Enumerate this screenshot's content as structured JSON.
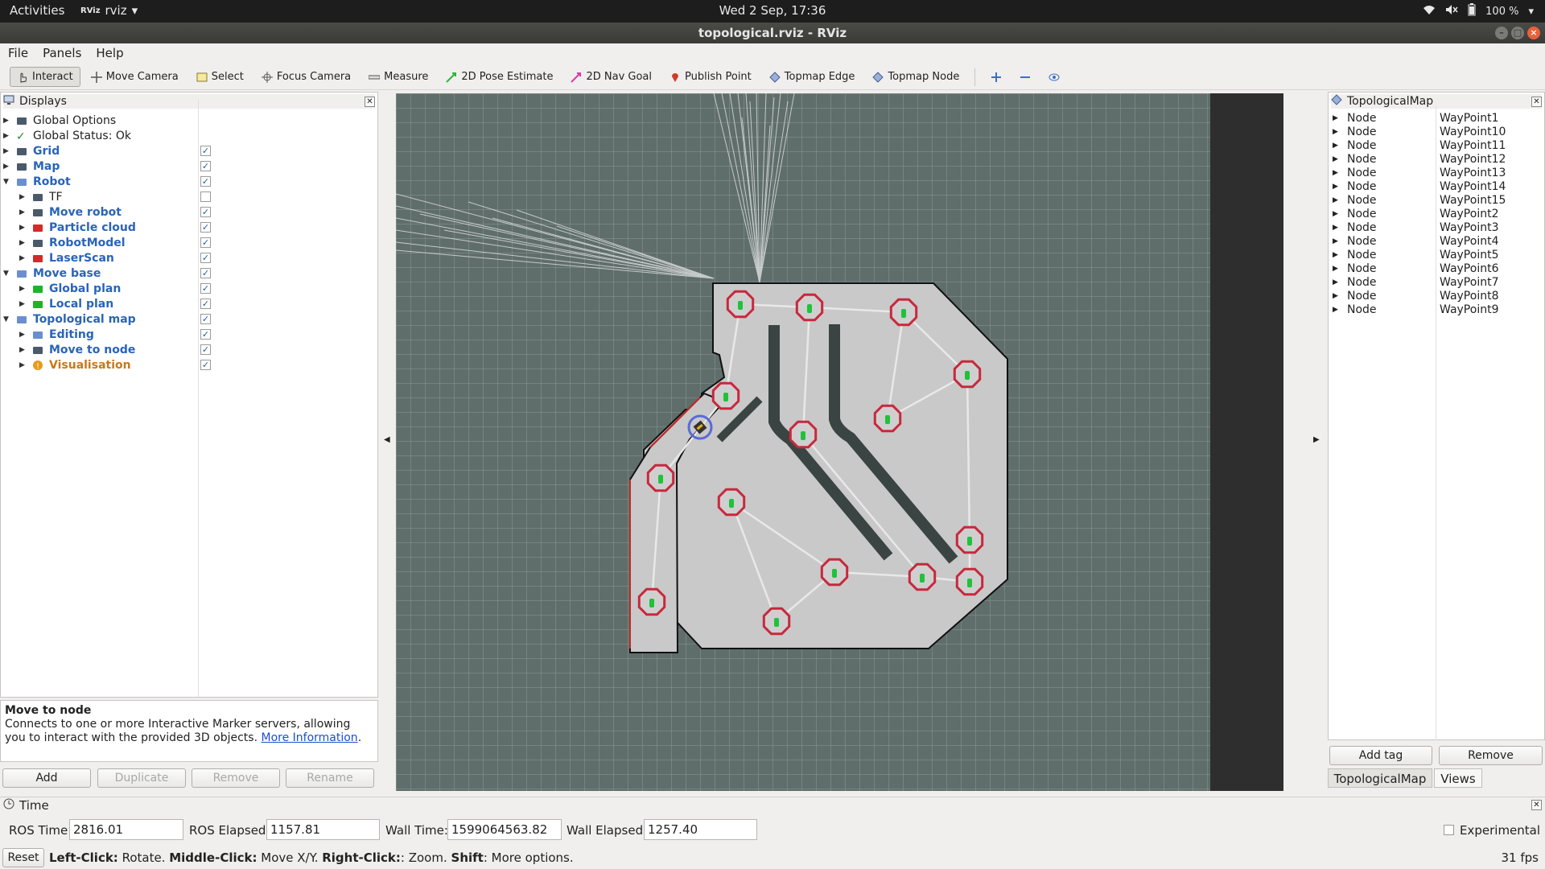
{
  "topbar": {
    "activities": "Activities",
    "app_badge": "RViz",
    "app_name": "rviz",
    "clock": "Wed  2 Sep, 17:36",
    "battery": "100 %"
  },
  "window": {
    "title": "topological.rviz - RViz"
  },
  "menu": {
    "file": "File",
    "panels": "Panels",
    "help": "Help"
  },
  "toolbar": {
    "interact": "Interact",
    "move_camera": "Move Camera",
    "select": "Select",
    "focus_camera": "Focus Camera",
    "measure": "Measure",
    "pose_estimate": "2D Pose Estimate",
    "nav_goal": "2D Nav Goal",
    "publish_point": "Publish Point",
    "topmap_edge": "Topmap Edge",
    "topmap_node": "Topmap Node"
  },
  "displays": {
    "title": "Displays",
    "items": [
      {
        "label": "Global Options",
        "style": "plain",
        "check": null
      },
      {
        "label": "Global Status: Ok",
        "style": "plain",
        "check": null
      },
      {
        "label": "Grid",
        "style": "blue",
        "check": "✓"
      },
      {
        "label": "Map",
        "style": "blue",
        "check": "✓"
      },
      {
        "label": "Robot",
        "style": "blue",
        "check": "✓"
      },
      {
        "label": "TF",
        "style": "plain",
        "check": ""
      },
      {
        "label": "Move robot",
        "style": "blue",
        "check": "✓"
      },
      {
        "label": "Particle cloud",
        "style": "blue",
        "check": "✓"
      },
      {
        "label": "RobotModel",
        "style": "blue",
        "check": "✓"
      },
      {
        "label": "LaserScan",
        "style": "blue",
        "check": "✓"
      },
      {
        "label": "Move base",
        "style": "blue",
        "check": "✓"
      },
      {
        "label": "Global plan",
        "style": "blue",
        "check": "✓"
      },
      {
        "label": "Local plan",
        "style": "blue",
        "check": "✓"
      },
      {
        "label": "Topological map",
        "style": "blue",
        "check": "✓"
      },
      {
        "label": "Editing",
        "style": "blue",
        "check": "✓"
      },
      {
        "label": "Move to node",
        "style": "blue",
        "check": "✓"
      },
      {
        "label": "Visualisation",
        "style": "orange",
        "check": "✓"
      }
    ],
    "description_title": "Move to node",
    "description_text": "Connects to one or more Interactive Marker servers, allowing you to interact with the provided 3D objects.",
    "description_link": "More Information",
    "description_end": ".",
    "add": "Add",
    "duplicate": "Duplicate",
    "remove": "Remove",
    "rename": "Rename"
  },
  "topomap": {
    "title": "TopologicalMap",
    "nodes": [
      {
        "key": "Node",
        "value": "WayPoint1"
      },
      {
        "key": "Node",
        "value": "WayPoint10"
      },
      {
        "key": "Node",
        "value": "WayPoint11"
      },
      {
        "key": "Node",
        "value": "WayPoint12"
      },
      {
        "key": "Node",
        "value": "WayPoint13"
      },
      {
        "key": "Node",
        "value": "WayPoint14"
      },
      {
        "key": "Node",
        "value": "WayPoint15"
      },
      {
        "key": "Node",
        "value": "WayPoint2"
      },
      {
        "key": "Node",
        "value": "WayPoint3"
      },
      {
        "key": "Node",
        "value": "WayPoint4"
      },
      {
        "key": "Node",
        "value": "WayPoint5"
      },
      {
        "key": "Node",
        "value": "WayPoint6"
      },
      {
        "key": "Node",
        "value": "WayPoint7"
      },
      {
        "key": "Node",
        "value": "WayPoint8"
      },
      {
        "key": "Node",
        "value": "WayPoint9"
      }
    ],
    "add_tag": "Add tag",
    "remove": "Remove",
    "tab_topomap": "TopologicalMap",
    "tab_views": "Views"
  },
  "time": {
    "title": "Time",
    "ros_time_label": "ROS Time:",
    "ros_time": "2816.01",
    "ros_elapsed_label": "ROS Elapsed:",
    "ros_elapsed": "1157.81",
    "wall_time_label": "Wall Time:",
    "wall_time": "1599064563.82",
    "wall_elapsed_label": "Wall Elapsed:",
    "wall_elapsed": "1257.40",
    "experimental": "Experimental"
  },
  "status": {
    "reset": "Reset",
    "left_click": "Left-Click:",
    "left_action": " Rotate. ",
    "middle_click": "Middle-Click:",
    "middle_action": " Move X/Y. ",
    "right_click": "Right-Click:",
    "right_action": ": Zoom. ",
    "shift": "Shift",
    "shift_action": ": More options.",
    "fps": "31 fps"
  },
  "colors": {
    "view_bg": "#5f6e6b",
    "free_space": "#c8c8c8",
    "node_ring": "#c8283c",
    "node_marker": "#1fc23a",
    "edge": "#e8e8e8"
  }
}
